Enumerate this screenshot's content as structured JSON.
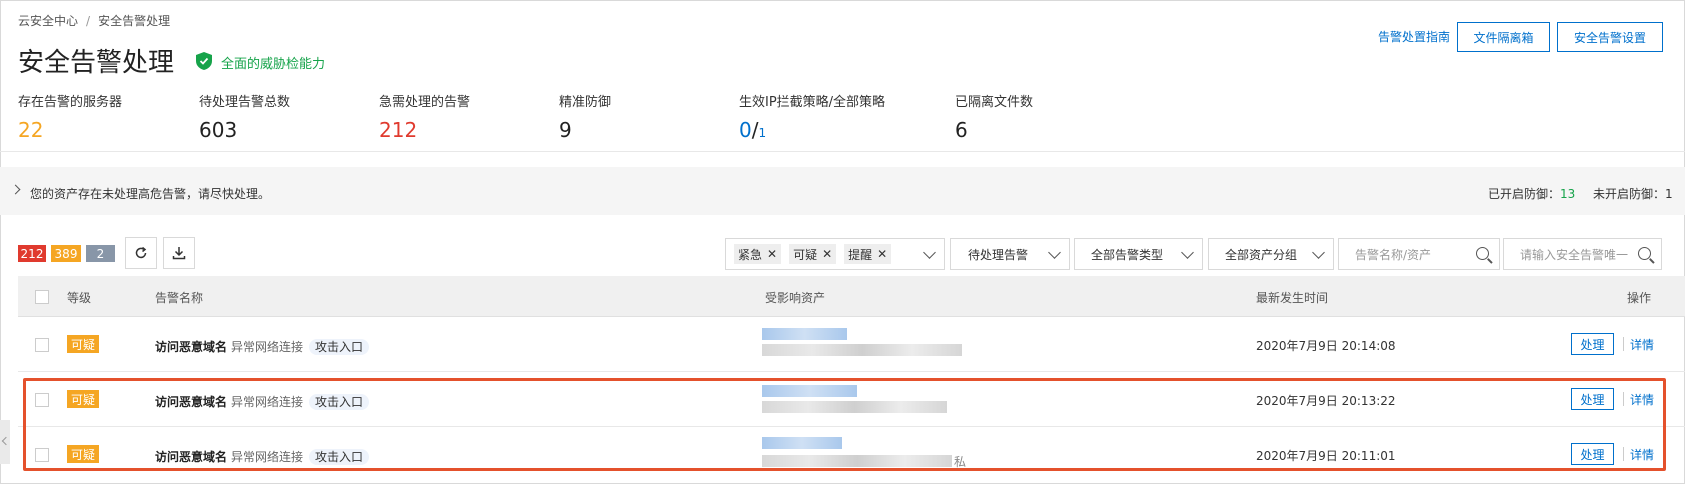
{
  "breadcrumb": [
    "云安全中心",
    "安全告警处理"
  ],
  "breadcrumb_sep": "/",
  "page_title": "安全告警处理",
  "capability": "全面的威胁检能力",
  "header_actions": {
    "guide": "告警处置指南",
    "quarantine": "文件隔离箱",
    "settings": "安全告警设置"
  },
  "stats": [
    {
      "label": "存在告警的服务器",
      "value": "22"
    },
    {
      "label": "待处理告警总数",
      "value": "603"
    },
    {
      "label": "急需处理的告警",
      "value": "212"
    },
    {
      "label": "精准防御",
      "value": "9"
    },
    {
      "label": "生效IP拦截策略/全部策略",
      "value": "0",
      "sep": "/",
      "total": "1"
    },
    {
      "label": "已隔离文件数",
      "value": "6"
    }
  ],
  "notice": {
    "text": "您的资产存在未处理高危告警，请尽快处理。",
    "enabled_label": "已开启防御：",
    "enabled_count": "13",
    "disabled_label": "未开启防御：",
    "disabled_count": "1"
  },
  "counts": {
    "urgent": "212",
    "suspicious": "389",
    "reminder": "2"
  },
  "filters": {
    "tags": [
      "紧急",
      "可疑",
      "提醒"
    ],
    "status": "待处理告警",
    "type": "全部告警类型",
    "group": "全部资产分组",
    "name_placeholder": "告警名称/资产",
    "id_placeholder": "请输入安全告警唯一"
  },
  "table": {
    "columns": {
      "level": "等级",
      "name": "告警名称",
      "asset": "受影响资产",
      "time": "最新发生时间",
      "action": "操作"
    },
    "rows": [
      {
        "level": "可疑",
        "name": "访问恶意域名",
        "type": "异常网络连接",
        "tag": "攻击入口",
        "time": "2020年7月9日 20:14:08",
        "handle": "处理",
        "detail": "详情"
      },
      {
        "level": "可疑",
        "name": "访问恶意域名",
        "type": "异常网络连接",
        "tag": "攻击入口",
        "time": "2020年7月9日 20:13:22",
        "handle": "处理",
        "detail": "详情"
      },
      {
        "level": "可疑",
        "name": "访问恶意域名",
        "type": "异常网络连接",
        "tag": "攻击入口",
        "time": "2020年7月9日 20:11:01",
        "handle": "处理",
        "detail": "详情",
        "asset_suffix": "私"
      }
    ]
  },
  "colors": {
    "accent": "#0070cc",
    "urgent": "#e03a2e",
    "suspicious": "#f5a623",
    "reminder": "#8896a8",
    "highlight": "#e4512c"
  }
}
